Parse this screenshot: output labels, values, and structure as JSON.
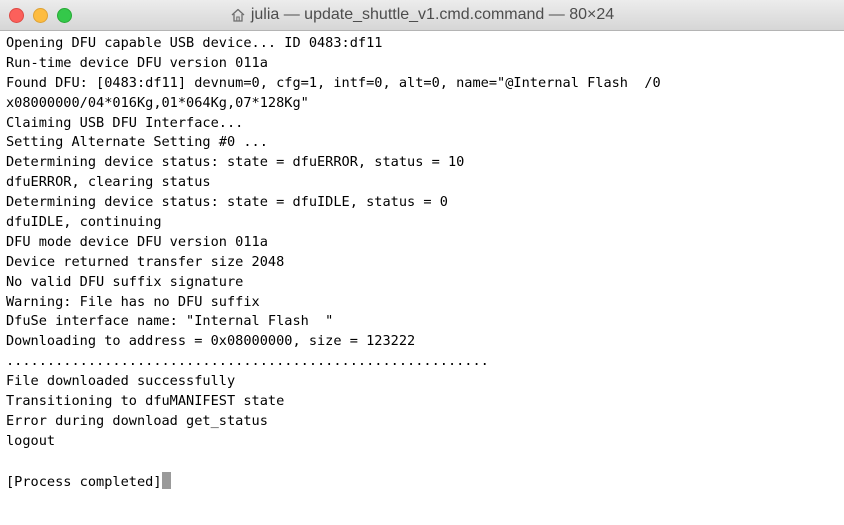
{
  "window": {
    "title": "julia — update_shuttle_v1.cmd.command — 80×24",
    "title_icon": "home-icon",
    "traffic_lights": {
      "close_color": "#fc605b",
      "minimize_color": "#fdbc40",
      "zoom_color": "#34c84a"
    }
  },
  "terminal": {
    "lines": [
      "Opening DFU capable USB device... ID 0483:df11",
      "Run-time device DFU version 011a",
      "Found DFU: [0483:df11] devnum=0, cfg=1, intf=0, alt=0, name=\"@Internal Flash  /0",
      "x08000000/04*016Kg,01*064Kg,07*128Kg\"",
      "Claiming USB DFU Interface...",
      "Setting Alternate Setting #0 ...",
      "Determining device status: state = dfuERROR, status = 10",
      "dfuERROR, clearing status",
      "Determining device status: state = dfuIDLE, status = 0",
      "dfuIDLE, continuing",
      "DFU mode device DFU version 011a",
      "Device returned transfer size 2048",
      "No valid DFU suffix signature",
      "Warning: File has no DFU suffix",
      "DfuSe interface name: \"Internal Flash  \"",
      "Downloading to address = 0x08000000, size = 123222",
      "...........................................................",
      "File downloaded successfully",
      "Transitioning to dfuMANIFEST state",
      "Error during download get_status",
      "logout",
      "",
      "[Process completed]"
    ]
  }
}
